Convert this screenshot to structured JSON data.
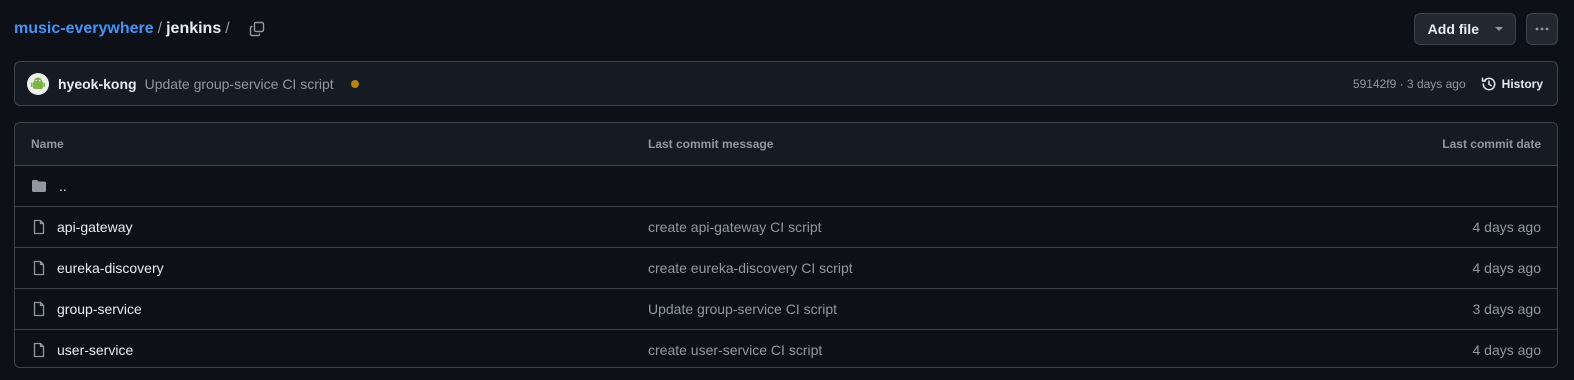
{
  "breadcrumb": {
    "repo": "music-everywhere",
    "separator": "/",
    "current": "jenkins",
    "trailing_separator": "/"
  },
  "toolbar": {
    "add_file_label": "Add file",
    "more_icon": "kebab-horizontal-icon",
    "copy_icon": "copy-icon"
  },
  "latest_commit": {
    "author": "hyeok-kong",
    "message": "Update group-service CI script",
    "status_color": "#bb8009",
    "meta": "59142f9 · 3 days ago",
    "history_label": "History"
  },
  "table": {
    "headers": {
      "name": "Name",
      "message": "Last commit message",
      "date": "Last commit date"
    },
    "parent_dir": "..",
    "rows": [
      {
        "name": "api-gateway",
        "message": "create api-gateway CI script",
        "date": "4 days ago",
        "icon": "file-icon"
      },
      {
        "name": "eureka-discovery",
        "message": "create eureka-discovery CI script",
        "date": "4 days ago",
        "icon": "file-icon"
      },
      {
        "name": "group-service",
        "message": "Update group-service CI script",
        "date": "3 days ago",
        "icon": "file-icon"
      },
      {
        "name": "user-service",
        "message": "create user-service CI script",
        "date": "4 days ago",
        "icon": "file-icon"
      }
    ]
  },
  "colors": {
    "background": "#0d1117",
    "link": "#4493f8",
    "muted": "#9198a1",
    "border": "#3d444d"
  }
}
